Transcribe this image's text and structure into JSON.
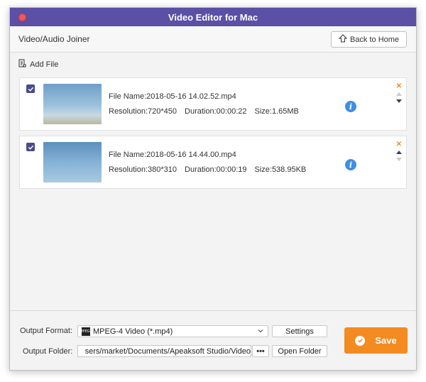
{
  "window": {
    "title": "Video Editor for Mac"
  },
  "header": {
    "page_title": "Video/Audio Joiner",
    "back_label": "Back to Home"
  },
  "toolbar": {
    "add_file_label": "Add File"
  },
  "files": [
    {
      "checked": true,
      "file_name": "File Name:2018-05-16 14.02.52.mp4",
      "resolution": "Resolution:720*450",
      "duration": "Duration:00:00:22",
      "size": "Size:1.65MB"
    },
    {
      "checked": true,
      "file_name": "File Name:2018-05-16 14.44.00.mp4",
      "resolution": "Resolution:380*310",
      "duration": "Duration:00:00:19",
      "size": "Size:538.95KB"
    }
  ],
  "output": {
    "format_label": "Output Format:",
    "format_value": "MPEG-4 Video (*.mp4)",
    "format_icon_text": "MPEG4",
    "folder_label": "Output Folder:",
    "folder_value": "sers/market/Documents/Apeaksoft Studio/Video",
    "dots_label": "•••",
    "settings_label": "Settings",
    "open_folder_label": "Open Folder",
    "save_label": "Save"
  },
  "icons": {
    "info": "i",
    "remove": "✕"
  },
  "colors": {
    "titlebar": "#5b4fa6",
    "save": "#f48b20",
    "checkbox": "#4a4a8e",
    "info": "#3f8fe0",
    "remove": "#f08a24"
  }
}
